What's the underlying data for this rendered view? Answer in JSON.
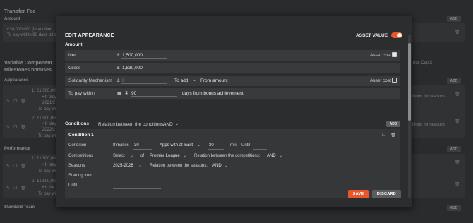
{
  "background": {
    "transfer_fee_title": "Transfer Fee",
    "amount_label": "Amount",
    "amount_value": "£30,000,000 (in addition,",
    "amount_note": "To pay within 90 days after",
    "variable_component": "Variable Component",
    "milestones_bonuses": "Milestones bonuses",
    "appearance_label": "Appearance",
    "bonus_cap": "nus Cap £",
    "appearance_items": [
      {
        "line1": "1) £1,500,00",
        "line2": "• If playe",
        "line3": "2021/2",
        "line4": "To pay with"
      },
      {
        "line1": "2) £1,500,00",
        "line2": "• If playe",
        "line3": "2022/2",
        "line4": "To pay with"
      }
    ],
    "right_texts": [
      "itions for seasons",
      "itions for seasons"
    ],
    "performance_label": "Performance",
    "performance_items": [
      {
        "line1": "1) £1,500,00",
        "line2": "• If playe",
        "line3": "To pay with"
      },
      {
        "line1": "2) £1,500,00",
        "line2": "• If the p",
        "line3": "To pay with"
      }
    ],
    "standard_team_label": "Standard Team",
    "add_label": "ADD"
  },
  "modal": {
    "title": "EDIT APPEARANCE",
    "asset_value_label": "ASSET VALUE",
    "asset_value_on": true,
    "amount_section": "Amount",
    "rows": {
      "net": {
        "label": "Net",
        "currency": "£",
        "value": "1,500,000",
        "asset_cost_label": "Asset cost",
        "asset_cost_checked": true
      },
      "gross": {
        "label": "Gross",
        "currency": "£",
        "value": "1,830,000"
      },
      "solidarity": {
        "label": "Solidarity Mechanism",
        "currency": "£",
        "value": "0",
        "mode": "To add",
        "from": "From amount",
        "asset_cost_label": "Asset cost",
        "asset_cost_checked": false
      },
      "pay_within": {
        "label": "To pay within",
        "value": "90",
        "suffix": "days from bonus achievement"
      }
    },
    "conditions": {
      "title": "Conditions",
      "relation_label": "Relation between the conditions:",
      "relation_value": "AND",
      "add_label": "ADD",
      "condition1": {
        "title": "Condition 1",
        "condition_label": "Condition",
        "if_makes": "If makes",
        "count": "30",
        "apps_mode": "Apps with at least",
        "minutes": "30",
        "min_label": "min",
        "until_label": "Until",
        "competitions_label": "Competitions",
        "competitions_select": "Select",
        "of_label": "of",
        "league": "Premier League",
        "relation_competitions_label": "Relation between the competitions:",
        "relation_competitions_value": "AND",
        "seasons_label": "Seasons",
        "season": "2025-2026",
        "relation_seasons_label": "Relation between the seasons:",
        "relation_seasons_value": "AND",
        "starting_from_label": "Starting from",
        "until_row_label": "Until"
      }
    },
    "save_label": "SAVE",
    "discard_label": "DISCARD"
  },
  "colors": {
    "accent": "#e8572a",
    "modal_bg": "#2b2d2f",
    "page_bg": "#3d3f41"
  }
}
